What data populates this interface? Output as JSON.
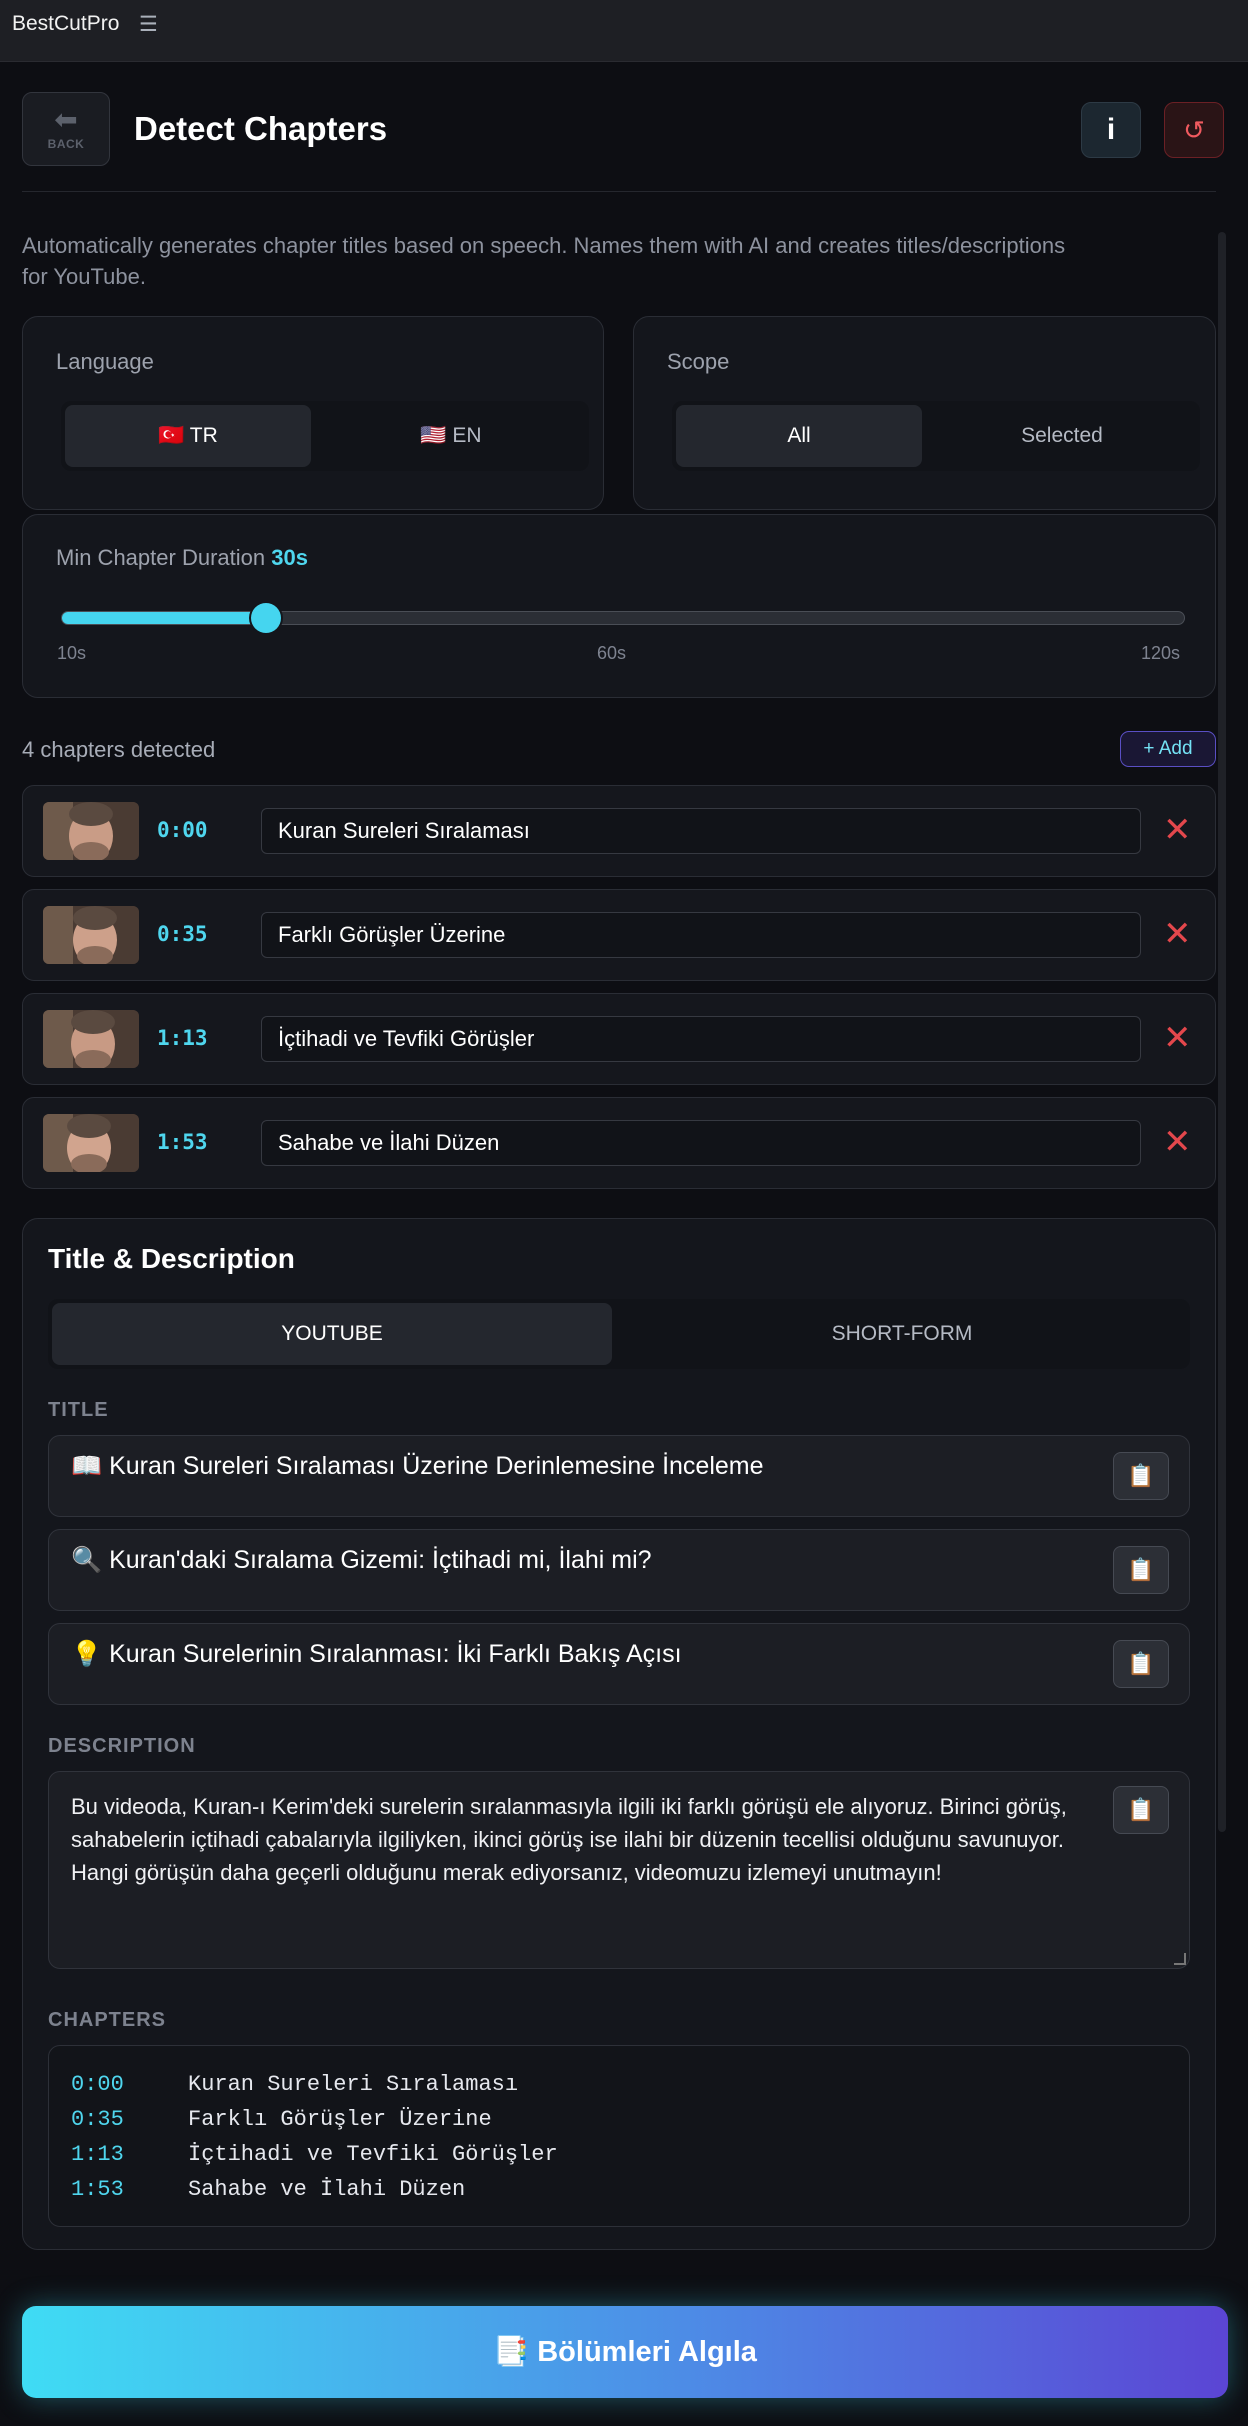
{
  "app": {
    "brand": "BestCutPro",
    "menu_icon": "☰"
  },
  "header": {
    "back_icon": "⬅",
    "back_label": "BACK",
    "title": "Detect Chapters",
    "info_label": "i",
    "reset_icon": "↺"
  },
  "description": "Automatically generates chapter titles based on speech. Names them with AI and creates titles/descriptions for YouTube.",
  "language": {
    "label": "Language",
    "options": [
      "🇹🇷 TR",
      "🇺🇸 EN"
    ],
    "selected": "🇹🇷 TR"
  },
  "scope": {
    "label": "Scope",
    "options": [
      "All",
      "Selected"
    ],
    "selected": "All"
  },
  "min_duration": {
    "label": "Min Chapter Duration",
    "value_text": "30s",
    "value": 30,
    "min": 10,
    "max": 120,
    "ticks": [
      "10s",
      "60s",
      "120s"
    ]
  },
  "chapters": {
    "count_text": "4 chapters detected",
    "add_label": "+ Add",
    "items": [
      {
        "time": "0:00",
        "title": "Kuran Sureleri Sıralaması"
      },
      {
        "time": "0:35",
        "title": "Farklı Görüşler Üzerine"
      },
      {
        "time": "1:13",
        "title": "İçtihadi ve Tevfiki Görüşler"
      },
      {
        "time": "1:53",
        "title": "Sahabe ve İlahi Düzen"
      }
    ]
  },
  "title_description": {
    "heading": "Title & Description",
    "tabs": [
      "YOUTUBE",
      "SHORT-FORM"
    ],
    "selected_tab": "YOUTUBE",
    "title_label": "TITLE",
    "titles": [
      "📖 Kuran Sureleri Sıralaması Üzerine Derinlemesine İnceleme",
      "🔍 Kuran'daki Sıralama Gizemi: İçtihadi mi, İlahi mi?",
      "💡 Kuran Surelerinin Sıralanması: İki Farklı Bakış Açısı"
    ],
    "description_label": "DESCRIPTION",
    "description_text": "Bu videoda, Kuran-ı Kerim'deki surelerin sıralanmasıyla ilgili iki farklı görüşü ele alıyoruz. Birinci görüş, sahabelerin içtihadi çabalarıyla ilgiliyken, ikinci görüş ise ilahi bir düzenin tecellisi olduğunu savunuyor. Hangi görüşün daha geçerli olduğunu merak ediyorsanız, videomuzu izlemeyi unutmayın!",
    "chapters_label": "CHAPTERS",
    "copy_icon": "📋"
  },
  "cta": {
    "label": "📑 Bölümleri Algıla"
  },
  "colors": {
    "accent": "#45d5ef",
    "danger": "#e3474c",
    "gradient_end": "#5b45d4"
  }
}
